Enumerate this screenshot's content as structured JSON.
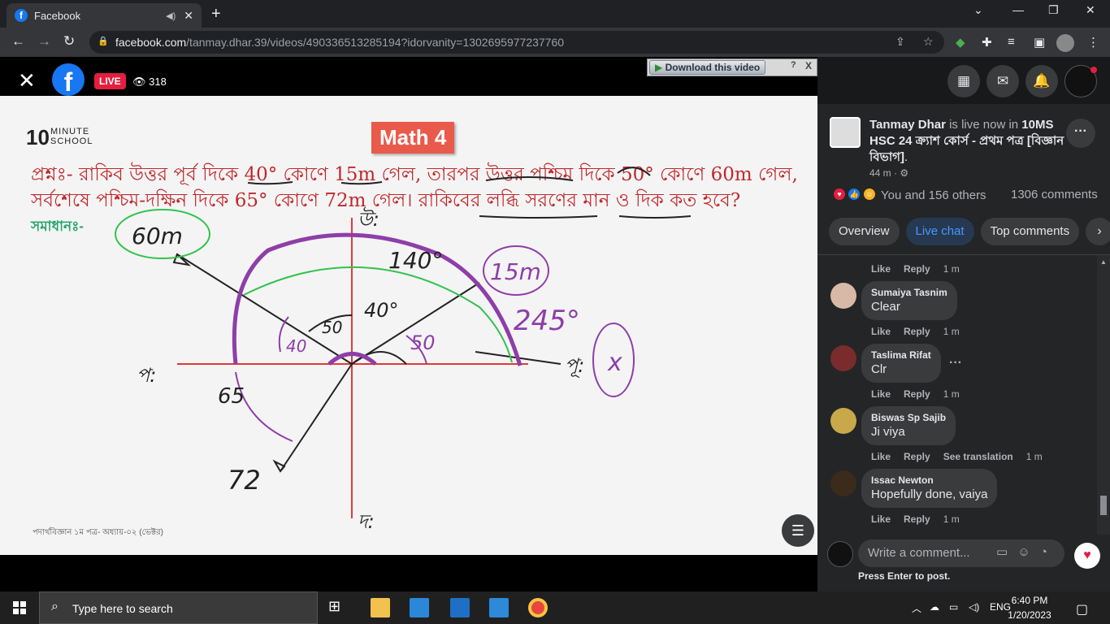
{
  "browser": {
    "tab_title": "Facebook",
    "tab_icon": "f",
    "url_host": "facebook.com",
    "url_path": "/tanmay.dhar.39/videos/490336513285194?idorvanity=1302695977237760"
  },
  "video": {
    "live_label": "LIVE",
    "viewer_count": "318",
    "download_label": "Download this video",
    "download_help": "?",
    "download_close": "X",
    "brand_number": "10",
    "brand_name_1": "MINUTE",
    "brand_name_2": "SCHOOL",
    "badge": "Math 4",
    "question_line1": "প্রশ্নঃ- রাকিব উত্তর পূর্ব দিকে 40° কোণে 15m গেল, তারপর উত্তর পশ্চিম দিকে 50° কোণে 60m গেল,",
    "question_line2": "সর্বশেষে পশ্চিম-দক্ষিন দিকে 65° কোণে 72m গেল। রাকিবের লব্ধি সরণের মান ও দিক কত হবে?",
    "solution_label": "সমাধানঃ-",
    "footer_text": "পদার্থবিজ্ঞান ১ম পত্র- অধ্যায়-০২ (ভেক্টর)",
    "diagram": {
      "north": "উ:",
      "south": "দ:",
      "east": "পূ:",
      "west": "প:",
      "label_60m": "60m",
      "label_15m": "15m",
      "label_140": "140°",
      "label_245": "245°",
      "label_40a": "40°",
      "label_40b": "40",
      "label_50a": "50",
      "label_50b": "50",
      "label_65": "65",
      "label_72": "72",
      "label_x": "x"
    }
  },
  "panel": {
    "poster_name": "Tanmay Dhar",
    "live_text": " is live now in ",
    "group_name": "10MS HSC 24 ক্র্যাশ কোর্স - প্রথম পত্র [বিজ্ঞান বিভাগ]",
    "group_suffix": ".",
    "post_time": "44 m ·",
    "reactions_text": "You and 156 others",
    "comment_count": "1306 comments",
    "tabs": [
      "Overview",
      "Live chat",
      "Top comments"
    ],
    "like_label": "Like",
    "reply_label": "Reply",
    "see_translation": "See translation",
    "first_meta_time": "1 m",
    "comments": [
      {
        "name": "Sumaiya Tasnim",
        "text": "Clear",
        "time": "1 m"
      },
      {
        "name": "Taslima Rifat",
        "text": "Clr",
        "time": "1 m"
      },
      {
        "name": "Biswas Sp Sajib",
        "text": "Ji viya",
        "time": "1 m"
      },
      {
        "name": "Issac Newton",
        "text": "Hopefully done, vaiya",
        "time": "1 m"
      }
    ],
    "write_placeholder": "Write a comment...",
    "press_enter": "Press Enter to post."
  },
  "taskbar": {
    "search_placeholder": "Type here to search",
    "lang": "ENG",
    "time": "6:40 PM",
    "date": "1/20/2023"
  },
  "colors": {
    "facebook_blue": "#1877f2",
    "live_red": "#e41e3f",
    "question_red": "#c0282d",
    "solution_green": "#21a56b",
    "ink_purple": "#8e3ea8"
  }
}
